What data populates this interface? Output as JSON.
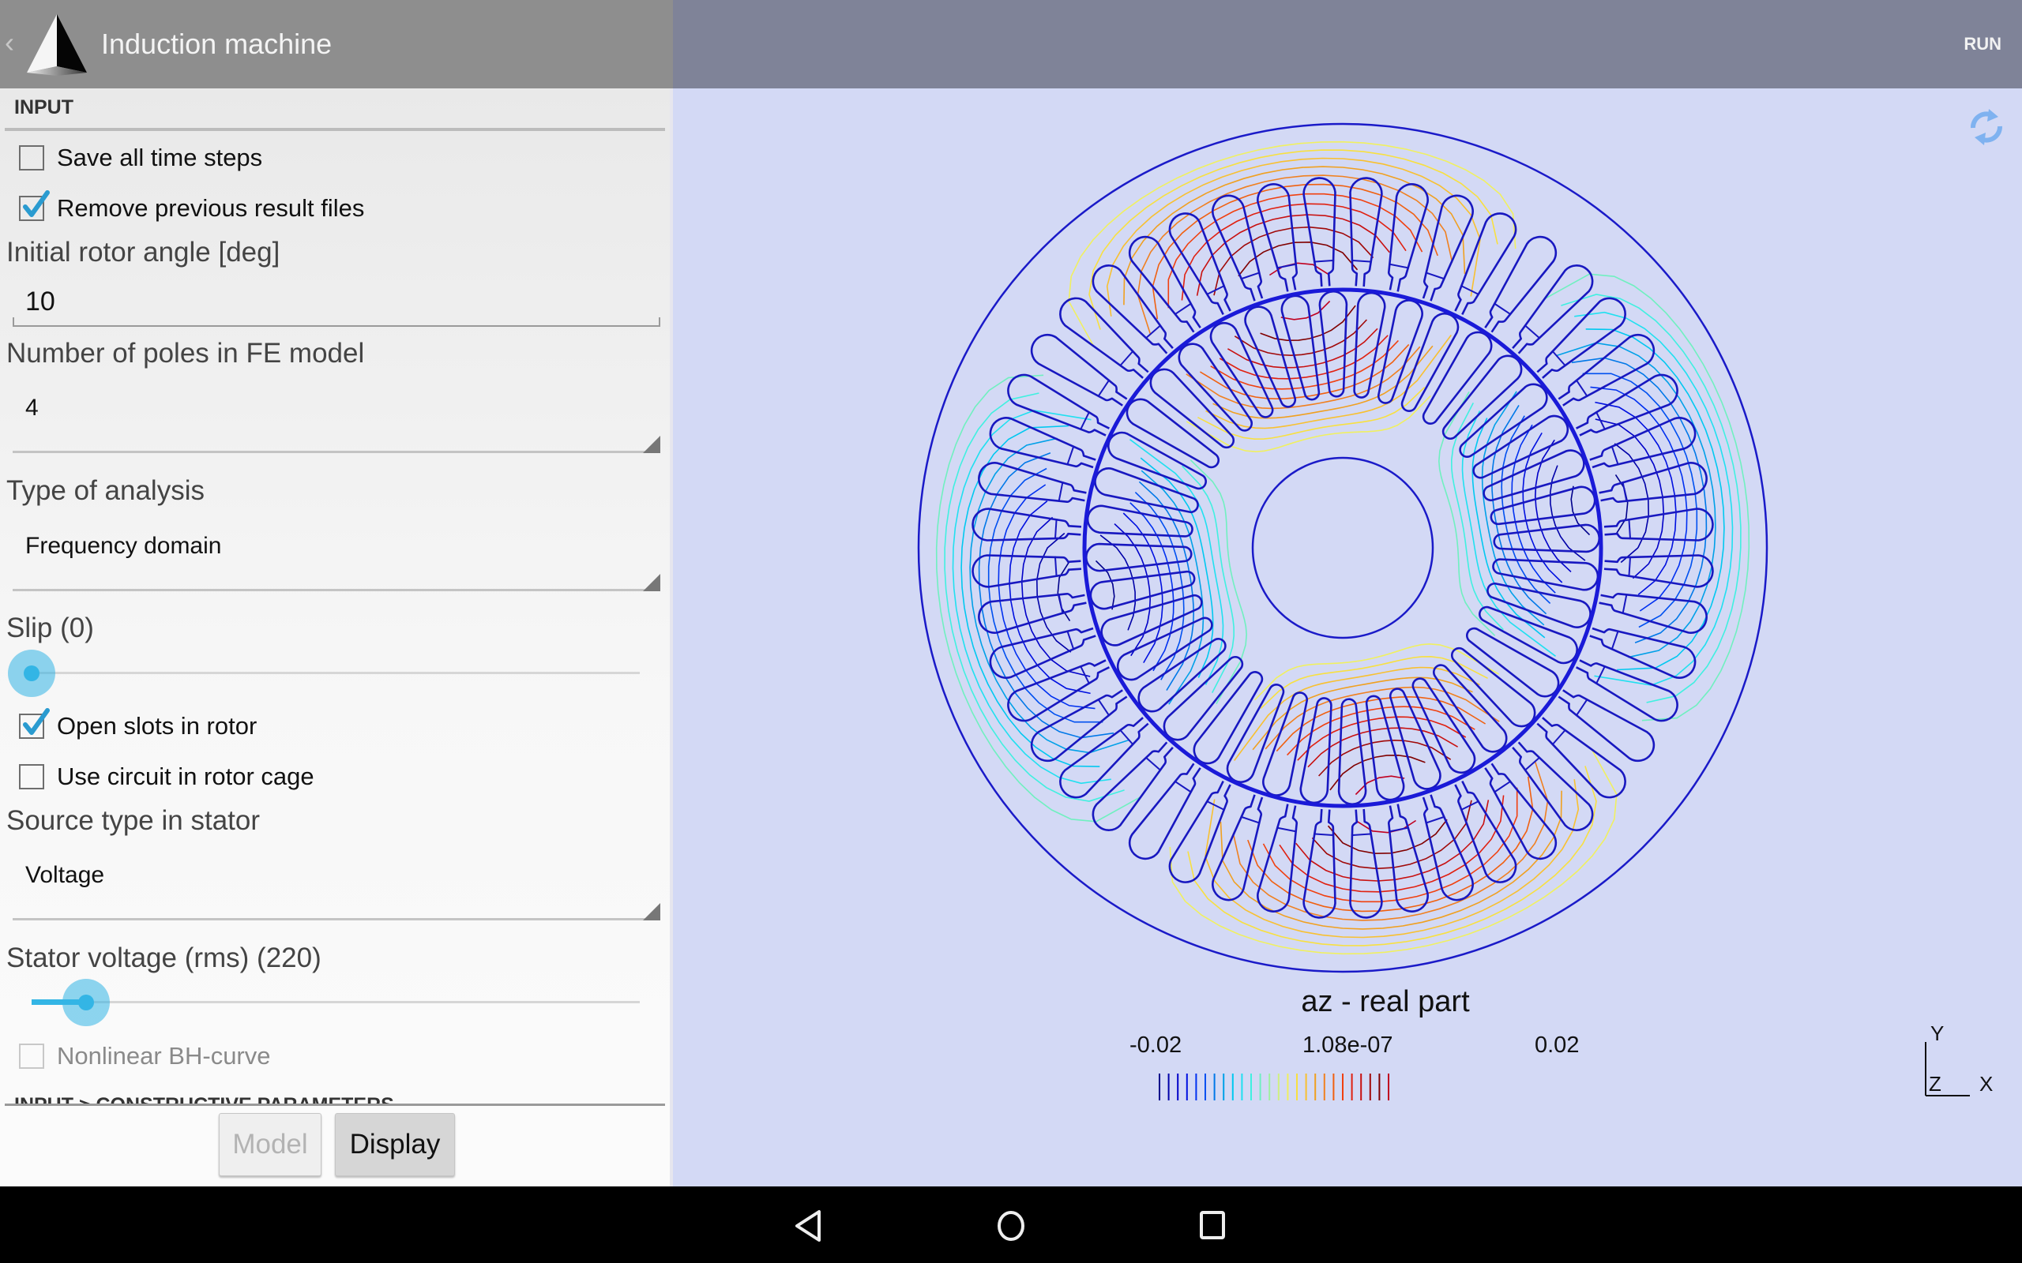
{
  "header": {
    "back_icon": "chevron-left-icon",
    "logo_icon": "pyramid-logo-icon",
    "title": "Induction machine",
    "run_label": "RUN"
  },
  "panel": {
    "section_title": "INPUT",
    "save_all_time_steps": {
      "label": "Save all time steps",
      "checked": false
    },
    "remove_previous_results": {
      "label": "Remove previous result files",
      "checked": true
    },
    "initial_rotor_angle": {
      "label": "Initial rotor angle [deg]",
      "value": "10"
    },
    "number_of_poles": {
      "label": "Number of poles in FE model",
      "value": "4"
    },
    "type_of_analysis": {
      "label": "Type of analysis",
      "value": "Frequency domain"
    },
    "slip": {
      "label": "Slip (0)",
      "fraction": 0.0
    },
    "open_slots_in_rotor": {
      "label": "Open slots in rotor",
      "checked": true
    },
    "use_circuit_in_rotor_cage": {
      "label": "Use circuit in rotor cage",
      "checked": false
    },
    "source_type_in_stator": {
      "label": "Source type in stator",
      "value": "Voltage"
    },
    "stator_voltage": {
      "label": "Stator voltage (rms) (220)",
      "fraction": 0.09
    },
    "nonlinear_bh_curve": {
      "label": "Nonlinear BH-curve",
      "checked": false,
      "disabled": true
    },
    "next_section_title": "INPUT > CONSTRUCTIVE PARAMETERS"
  },
  "buttons": {
    "model_label": "Model",
    "display_label": "Display"
  },
  "viewer": {
    "refresh_icon": "refresh-icon",
    "plot_title": "az - real part",
    "scale_min": "-0.02",
    "scale_mid": "1.08e-07",
    "scale_max": "0.02",
    "isoline_count": 26,
    "isoline_colors": [
      "#00008b",
      "#0000a8",
      "#0000c8",
      "#0010e0",
      "#0030f0",
      "#0050f0",
      "#0078e8",
      "#00a0e8",
      "#00c8f0",
      "#20e0f0",
      "#40f0e0",
      "#70f0c0",
      "#a0f0a0",
      "#d0f080",
      "#f0f060",
      "#f8e040",
      "#f8c030",
      "#f0a020",
      "#f08020",
      "#f06010",
      "#f04010",
      "#e02010",
      "#c81010",
      "#a00808",
      "#800000",
      "#c00020"
    ],
    "axes": {
      "y": "Y",
      "z": "Z",
      "x": "X"
    },
    "stator_slots": 48,
    "rotor_slots": 40,
    "field_poles": 4
  },
  "navbar": {
    "back_icon": "nav-back-icon",
    "home_icon": "nav-home-icon",
    "recents_icon": "nav-recents-icon"
  }
}
